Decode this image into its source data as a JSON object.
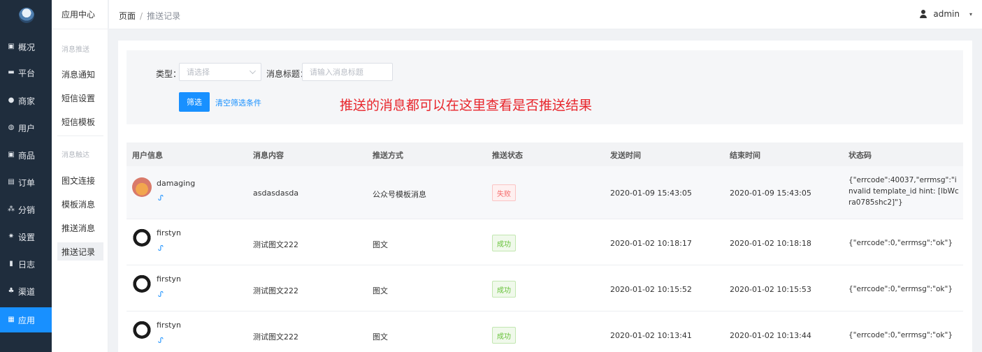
{
  "nav": {
    "items": [
      {
        "label": "概况",
        "icon": "dashboard-icon"
      },
      {
        "label": "平台",
        "icon": "monitor-icon"
      },
      {
        "label": "商家",
        "icon": "shop-icon"
      },
      {
        "label": "用户",
        "icon": "user-icon"
      },
      {
        "label": "商品",
        "icon": "goods-icon"
      },
      {
        "label": "订单",
        "icon": "order-icon"
      },
      {
        "label": "分销",
        "icon": "distribution-icon"
      },
      {
        "label": "设置",
        "icon": "gear-icon"
      },
      {
        "label": "日志",
        "icon": "log-icon"
      },
      {
        "label": "渠道",
        "icon": "channel-icon"
      },
      {
        "label": "应用",
        "icon": "apps-icon"
      }
    ],
    "active_index": 10,
    "accent_color": "#1890ff"
  },
  "submenu": {
    "title": "应用中心",
    "groups": [
      {
        "label": "消息推送",
        "items": [
          "消息通知",
          "短信设置",
          "短信模板"
        ]
      },
      {
        "label": "消息触达",
        "items": [
          "图文连接",
          "模板消息",
          "推送消息",
          "推送记录"
        ]
      }
    ],
    "active": "推送记录"
  },
  "breadcrumb": {
    "root": "页面",
    "separator": "/",
    "current": "推送记录"
  },
  "user": {
    "name": "admin",
    "caret": "▾"
  },
  "filter": {
    "type_label": "类型：",
    "type_placeholder": "请选择",
    "title_label": "消息标题：",
    "title_placeholder": "请输入消息标题",
    "submit_label": "筛选",
    "clear_label": "清空筛选条件"
  },
  "annotation": "推送的消息都可以在这里查看是否推送结果",
  "table": {
    "columns": [
      "用户信息",
      "消息内容",
      "推送方式",
      "推送状态",
      "发送时间",
      "结束时间",
      "状态码"
    ],
    "rows": [
      {
        "user": "damaging",
        "content": "asdasdasda",
        "method": "公众号模板消息",
        "status": "失败",
        "sent": "2020-01-09 15:43:05",
        "ended": "2020-01-09 15:43:05",
        "code": "{\"errcode\":40037,\"errmsg\":\"invalid template_id hint: [lbWcra0785shc2]\"}"
      },
      {
        "user": "firstyn",
        "content": "测试图文222",
        "method": "图文",
        "status": "成功",
        "sent": "2020-01-02 10:18:17",
        "ended": "2020-01-02 10:18:18",
        "code": "{\"errcode\":0,\"errmsg\":\"ok\"}"
      },
      {
        "user": "firstyn",
        "content": "测试图文222",
        "method": "图文",
        "status": "成功",
        "sent": "2020-01-02 10:15:52",
        "ended": "2020-01-02 10:15:53",
        "code": "{\"errcode\":0,\"errmsg\":\"ok\"}"
      },
      {
        "user": "firstyn",
        "content": "测试图文222",
        "method": "图文",
        "status": "成功",
        "sent": "2020-01-02 10:13:41",
        "ended": "2020-01-02 10:13:44",
        "code": "{\"errcode\":0,\"errmsg\":\"ok\"}"
      }
    ]
  },
  "colors": {
    "fail": "#f56c6c",
    "success": "#67c23a",
    "annotation": "#e8262c",
    "nav_bg": "#1f2d3d"
  }
}
